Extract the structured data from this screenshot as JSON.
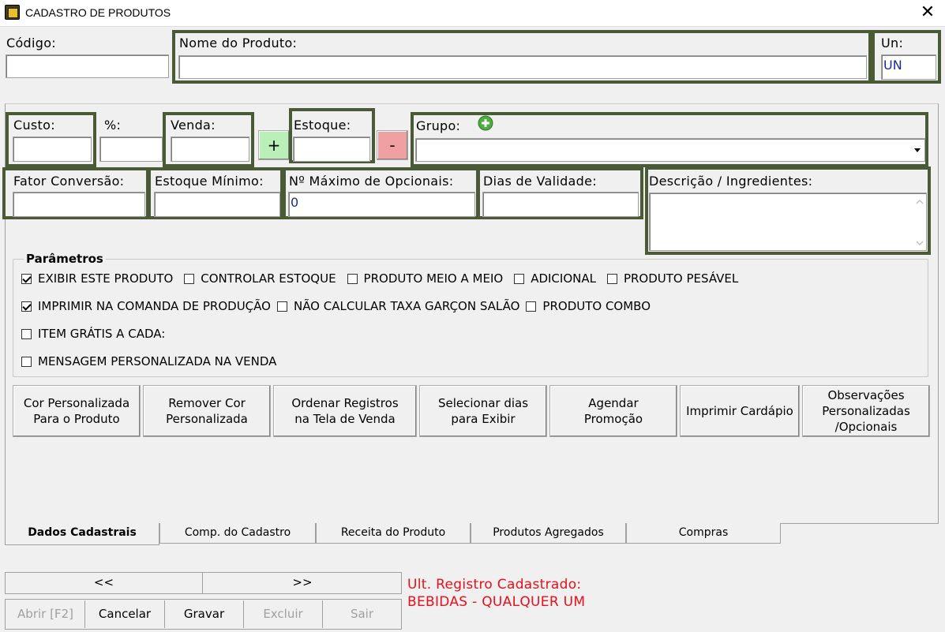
{
  "window": {
    "title": "CADASTRO DE PRODUTOS",
    "icon": "app-icon",
    "close": "✕"
  },
  "header": {
    "codigo": {
      "label": "Código:",
      "value": ""
    },
    "nome": {
      "label": "Nome do Produto:",
      "value": ""
    },
    "un": {
      "label": "Un:",
      "value": "UN"
    }
  },
  "fields": {
    "custo": {
      "label": "Custo:",
      "value": ""
    },
    "percent": {
      "label": "%:",
      "value": ""
    },
    "venda": {
      "label": "Venda:",
      "value": ""
    },
    "plus": "+",
    "estoque": {
      "label": "Estoque:",
      "value": ""
    },
    "minus": "-",
    "grupo": {
      "label": "Grupo:",
      "value": "",
      "add_icon": "plus-circle-icon"
    },
    "fator": {
      "label": "Fator Conversão:",
      "value": ""
    },
    "estoque_minimo": {
      "label": "Estoque Mínimo:",
      "value": ""
    },
    "max_opcionais": {
      "label": "Nº Máximo de Opcionais:",
      "value": "0"
    },
    "dias_validade": {
      "label": "Dias de Validade:",
      "value": ""
    },
    "descricao": {
      "label": "Descrição / Ingredientes:",
      "value": ""
    }
  },
  "parametros": {
    "title": "Parâmetros",
    "rows": [
      [
        {
          "label": "EXIBIR ESTE PRODUTO",
          "checked": true
        },
        {
          "label": "CONTROLAR ESTOQUE",
          "checked": false
        },
        {
          "label": "PRODUTO MEIO A MEIO",
          "checked": false
        },
        {
          "label": "ADICIONAL",
          "checked": false
        },
        {
          "label": "PRODUTO PESÁVEL",
          "checked": false
        }
      ],
      [
        {
          "label": "IMPRIMIR NA COMANDA DE PRODUÇÃO",
          "checked": true
        },
        {
          "label": "NÃO CALCULAR TAXA GARÇON SALÃO",
          "checked": false
        },
        {
          "label": "PRODUTO COMBO",
          "checked": false
        }
      ],
      [
        {
          "label": "ITEM GRÁTIS A CADA:",
          "checked": false
        }
      ],
      [
        {
          "label": "MENSAGEM PERSONALIZADA NA VENDA",
          "checked": false
        }
      ]
    ]
  },
  "actions": [
    "Cor Personalizada\nPara o Produto",
    "Remover Cor\nPersonalizada",
    "Ordenar Registros\nna Tela de Venda",
    "Selecionar dias\npara  Exibir",
    "Agendar\nPromoção",
    "Imprimir Cardápio",
    "Observações\nPersonalizadas\n/Opcionais"
  ],
  "tabs": [
    "Dados Cadastrais",
    "Comp. do Cadastro",
    "Receita do Produto",
    "Produtos Agregados",
    "Compras"
  ],
  "nav": {
    "prev": "<<",
    "next": ">>"
  },
  "bottom_buttons": [
    "Abrir [F2]",
    "Cancelar",
    "Gravar",
    "Excluir",
    "Sair"
  ],
  "last_record": {
    "label": "Ult. Registro Cadastrado:",
    "value": "BEBIDAS - QUALQUER UM"
  },
  "colors": {
    "highlight": "#4b5a36",
    "accent_text": "#1a2a9a",
    "warning": "#e8101a",
    "plus_btn": "#b8f0b8",
    "minus_btn": "#f0a0a0"
  }
}
